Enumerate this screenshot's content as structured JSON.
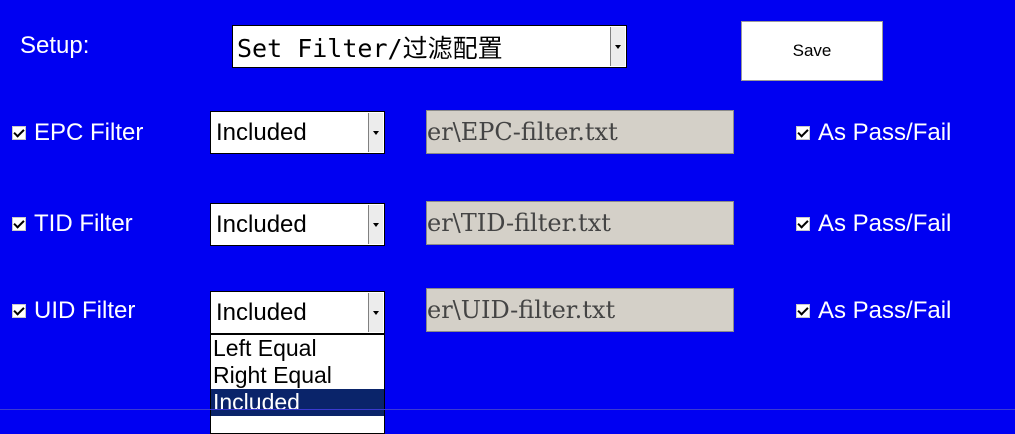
{
  "setup": {
    "label": "Setup:",
    "selected": "Set Filter/过滤配置"
  },
  "save_label": "Save",
  "filters": [
    {
      "label": "EPC Filter",
      "checked": true,
      "mode": "Included",
      "path": "er\\EPC-filter.txt",
      "pass_fail_label": "As Pass/Fail",
      "pass_fail_checked": true
    },
    {
      "label": "TID Filter",
      "checked": true,
      "mode": "Included",
      "path": "er\\TID-filter.txt",
      "pass_fail_label": "As Pass/Fail",
      "pass_fail_checked": true
    },
    {
      "label": "UID Filter",
      "checked": true,
      "mode": "Included",
      "path": "er\\UID-filter.txt",
      "pass_fail_label": "As Pass/Fail",
      "pass_fail_checked": true
    }
  ],
  "dropdown_options": [
    {
      "label": "Left Equal",
      "selected": false
    },
    {
      "label": "Right Equal",
      "selected": false
    },
    {
      "label": "Included",
      "selected": true
    }
  ],
  "colors": {
    "background": "#0000f2",
    "selected_option": "#0a246a",
    "path_box": "#d4d0c8"
  }
}
